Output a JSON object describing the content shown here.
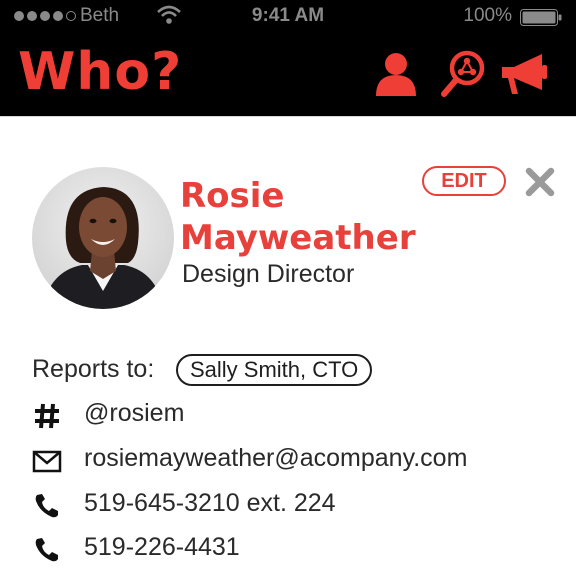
{
  "status_bar": {
    "carrier": "Beth",
    "time": "9:41 AM",
    "battery": "100%"
  },
  "app": {
    "logo": "Who?",
    "nav_icons": [
      "person-icon",
      "search-network-icon",
      "megaphone-icon"
    ]
  },
  "profile": {
    "first_name": "Rosie",
    "last_name": "Mayweather",
    "title": "Design Director",
    "edit_label": "EDIT",
    "reports_to_label": "Reports to:",
    "reports_to": "Sally Smith, CTO",
    "slack": "@rosiem",
    "email": "rosiemayweather@acompany.com",
    "phone_work": "519-645-3210 ext. 224",
    "phone_mobile": "519-226-4431"
  },
  "colors": {
    "accent": "#ef3e36",
    "bar": "#000000",
    "text": "#1e1e1e"
  }
}
